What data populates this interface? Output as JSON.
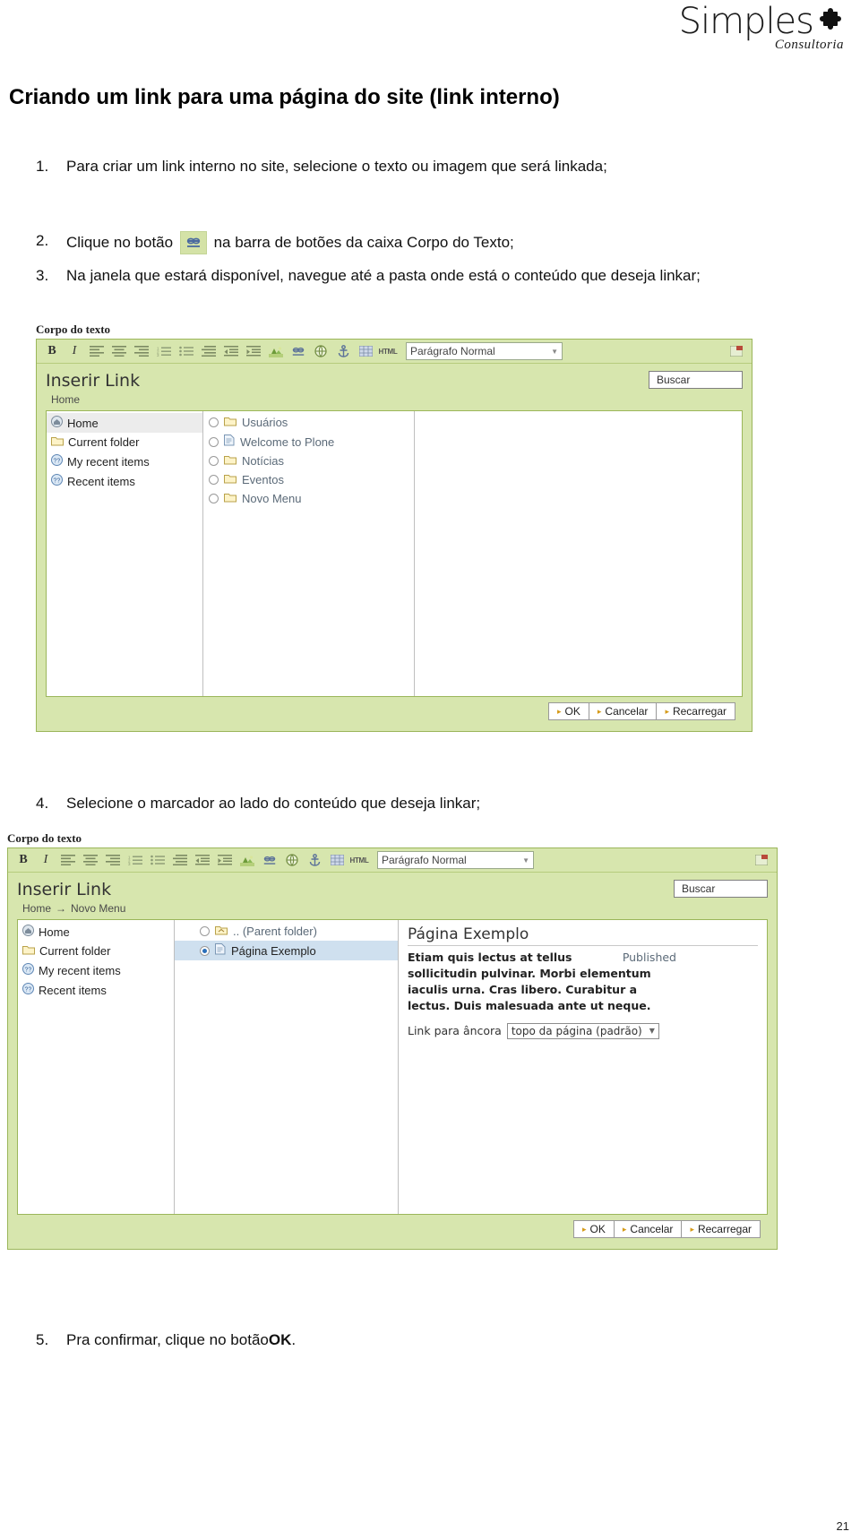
{
  "brand": {
    "name": "Simples",
    "tagline": "Consultoria",
    "logo_icon": "puzzle-piece-icon"
  },
  "page": {
    "title": "Criando um link para uma página do site (link interno)",
    "number": "21"
  },
  "steps": [
    {
      "num": "1.",
      "text": "Para criar um link interno no site, selecione o texto ou imagem que será linkada;"
    },
    {
      "num": "2.",
      "pre": "Clique no botão",
      "post": "na barra de botões da caixa Corpo do Texto;",
      "icon": "insert-link-icon"
    },
    {
      "num": "3.",
      "text": "Na janela que estará disponível, navegue até a pasta onde está o conteúdo que deseja linkar;"
    },
    {
      "num": "4.",
      "text": "Selecione o marcador ao lado do conteúdo que deseja linkar;"
    },
    {
      "num": "5.",
      "pre": "Pra confirmar, clique no botão",
      "bold": "OK",
      "post": "."
    }
  ],
  "editor": {
    "field_label": "Corpo do texto",
    "toolbar": {
      "buttons": [
        {
          "name": "bold-icon",
          "label": "B"
        },
        {
          "name": "italic-icon",
          "label": "I"
        },
        {
          "name": "align-left-icon",
          "label": ""
        },
        {
          "name": "align-center-icon",
          "label": ""
        },
        {
          "name": "align-right-icon",
          "label": ""
        },
        {
          "name": "ordered-list-icon",
          "label": ""
        },
        {
          "name": "unordered-list-icon",
          "label": ""
        },
        {
          "name": "justify-icon",
          "label": ""
        },
        {
          "name": "outdent-icon",
          "label": ""
        },
        {
          "name": "indent-icon",
          "label": ""
        },
        {
          "name": "insert-image-icon",
          "label": ""
        },
        {
          "name": "insert-link-icon",
          "label": ""
        },
        {
          "name": "external-link-icon",
          "label": ""
        },
        {
          "name": "anchor-icon",
          "label": ""
        },
        {
          "name": "insert-table-icon",
          "label": ""
        },
        {
          "name": "html-source-icon",
          "label": "HTML"
        }
      ],
      "style_select": "Parágrafo Normal",
      "maximize_icon": "maximize-editor-icon"
    }
  },
  "dialog1": {
    "title": "Inserir Link",
    "search_label": "Buscar",
    "breadcrumb": [
      "Home"
    ],
    "nav_items": [
      {
        "label": "Home",
        "icon": "home-icon",
        "selected": true
      },
      {
        "label": "Current folder",
        "icon": "folder-icon",
        "selected": false
      },
      {
        "label": "My recent items",
        "icon": "recent-items-icon",
        "selected": false
      },
      {
        "label": "Recent items",
        "icon": "recent-icon",
        "selected": false
      }
    ],
    "list_items": [
      {
        "label": "Usuários",
        "type": "folder",
        "selected": false
      },
      {
        "label": "Welcome to Plone",
        "type": "document",
        "selected": false
      },
      {
        "label": "Notícias",
        "type": "folder",
        "selected": false
      },
      {
        "label": "Eventos",
        "type": "folder",
        "selected": false
      },
      {
        "label": "Novo Menu",
        "type": "folder",
        "selected": false
      }
    ],
    "buttons": [
      {
        "label": "OK",
        "name": "ok-button"
      },
      {
        "label": "Cancelar",
        "name": "cancel-button"
      },
      {
        "label": "Recarregar",
        "name": "reload-button"
      }
    ]
  },
  "dialog2": {
    "title": "Inserir Link",
    "search_label": "Buscar",
    "breadcrumb": [
      "Home",
      "Novo Menu"
    ],
    "breadcrumb_separator": "→",
    "nav_items": [
      {
        "label": "Home",
        "icon": "home-icon",
        "selected": false
      },
      {
        "label": "Current folder",
        "icon": "folder-icon",
        "selected": false
      },
      {
        "label": "My recent items",
        "icon": "recent-items-icon",
        "selected": false
      },
      {
        "label": "Recent items",
        "icon": "recent-icon",
        "selected": false
      }
    ],
    "list_items": [
      {
        "label": ".. (Parent folder)",
        "type": "parent",
        "selected": false
      },
      {
        "label": "Página Exemplo",
        "type": "document",
        "selected": true
      }
    ],
    "detail": {
      "title": "Página Exemplo",
      "state": "Published",
      "body": "Etiam quis lectus at tellus sollicitudin pulvinar. Morbi elementum iaculis urna. Cras libero. Curabitur a lectus. Duis malesuada ante ut neque.",
      "anchor_label": "Link para âncora",
      "anchor_value": "topo da página (padrão)"
    },
    "buttons": [
      {
        "label": "OK",
        "name": "ok-button"
      },
      {
        "label": "Cancelar",
        "name": "cancel-button"
      },
      {
        "label": "Recarregar",
        "name": "reload-button"
      }
    ]
  }
}
